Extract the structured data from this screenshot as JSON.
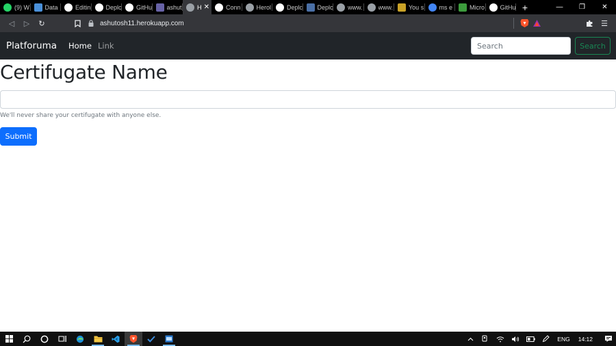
{
  "browser": {
    "tabs": [
      {
        "label": "(9) W",
        "icon": "whatsapp-icon",
        "color": "#25d366",
        "active": false
      },
      {
        "label": "Data",
        "icon": "data-icon",
        "color": "#4a90d9",
        "active": false
      },
      {
        "label": "Editin",
        "icon": "medium-icon",
        "color": "#ffffff",
        "active": false
      },
      {
        "label": "Deplc",
        "icon": "medium-icon",
        "color": "#ffffff",
        "active": false
      },
      {
        "label": "GitHu",
        "icon": "github-icon",
        "color": "#ffffff",
        "active": false
      },
      {
        "label": "ashut",
        "icon": "heroku-icon",
        "color": "#6762a6",
        "active": false
      },
      {
        "label": "H",
        "icon": "globe-icon",
        "color": "#9aa0a6",
        "active": true
      },
      {
        "label": "Conn",
        "icon": "github-icon",
        "color": "#ffffff",
        "active": false
      },
      {
        "label": "Herol",
        "icon": "globe-icon",
        "color": "#9aa0a6",
        "active": false
      },
      {
        "label": "Deplc",
        "icon": "medium-icon",
        "color": "#ffffff",
        "active": false
      },
      {
        "label": "Deplc",
        "icon": "mdn-icon",
        "color": "#4a6fa5",
        "active": false
      },
      {
        "label": "www.",
        "icon": "globe-icon",
        "color": "#9aa0a6",
        "active": false
      },
      {
        "label": "www.",
        "icon": "globe-icon",
        "color": "#9aa0a6",
        "active": false
      },
      {
        "label": "You s",
        "icon": "g-icon",
        "color": "#c9a227",
        "active": false
      },
      {
        "label": "ms e",
        "icon": "google-icon",
        "color": "#4285f4",
        "active": false
      },
      {
        "label": "Micro",
        "icon": "download-icon",
        "color": "#3c9b3c",
        "active": false
      },
      {
        "label": "GitHu",
        "icon": "github-icon",
        "color": "#ffffff",
        "active": false
      }
    ],
    "new_tab": "+",
    "window_controls": {
      "minimize": "—",
      "restore": "❐",
      "close": "✕"
    },
    "toolbar": {
      "back": "◁",
      "forward": "▷",
      "reload": "↻",
      "bookmark": "🔖",
      "url": "ashutosh11.herokuapp.com",
      "extensions": "✚",
      "menu": "☰"
    }
  },
  "navbar": {
    "brand": "Platforuma",
    "links": [
      {
        "label": "Home",
        "active": true
      },
      {
        "label": "Link",
        "active": false
      }
    ],
    "search": {
      "placeholder": "Search",
      "button_label": "Search"
    }
  },
  "form": {
    "title": "Certifugate Name",
    "input_value": "",
    "help_text": "We'll never share your certifugate with anyone else.",
    "submit_label": "Submit"
  },
  "taskbar": {
    "apps": [
      {
        "name": "start-icon",
        "open": false
      },
      {
        "name": "search-icon",
        "open": false
      },
      {
        "name": "cortana-icon",
        "open": false
      },
      {
        "name": "task-view-icon",
        "open": false
      },
      {
        "name": "edge-icon",
        "open": false
      },
      {
        "name": "file-explorer-icon",
        "open": true
      },
      {
        "name": "vscode-icon",
        "open": false
      },
      {
        "name": "brave-icon",
        "open": true
      },
      {
        "name": "todo-icon",
        "open": false
      },
      {
        "name": "app-icon",
        "open": true
      }
    ],
    "tray": {
      "language": "ENG",
      "time": "14:12"
    }
  },
  "colors": {
    "navbar_bg": "#212529",
    "primary": "#0d6efd",
    "success": "#198754"
  }
}
